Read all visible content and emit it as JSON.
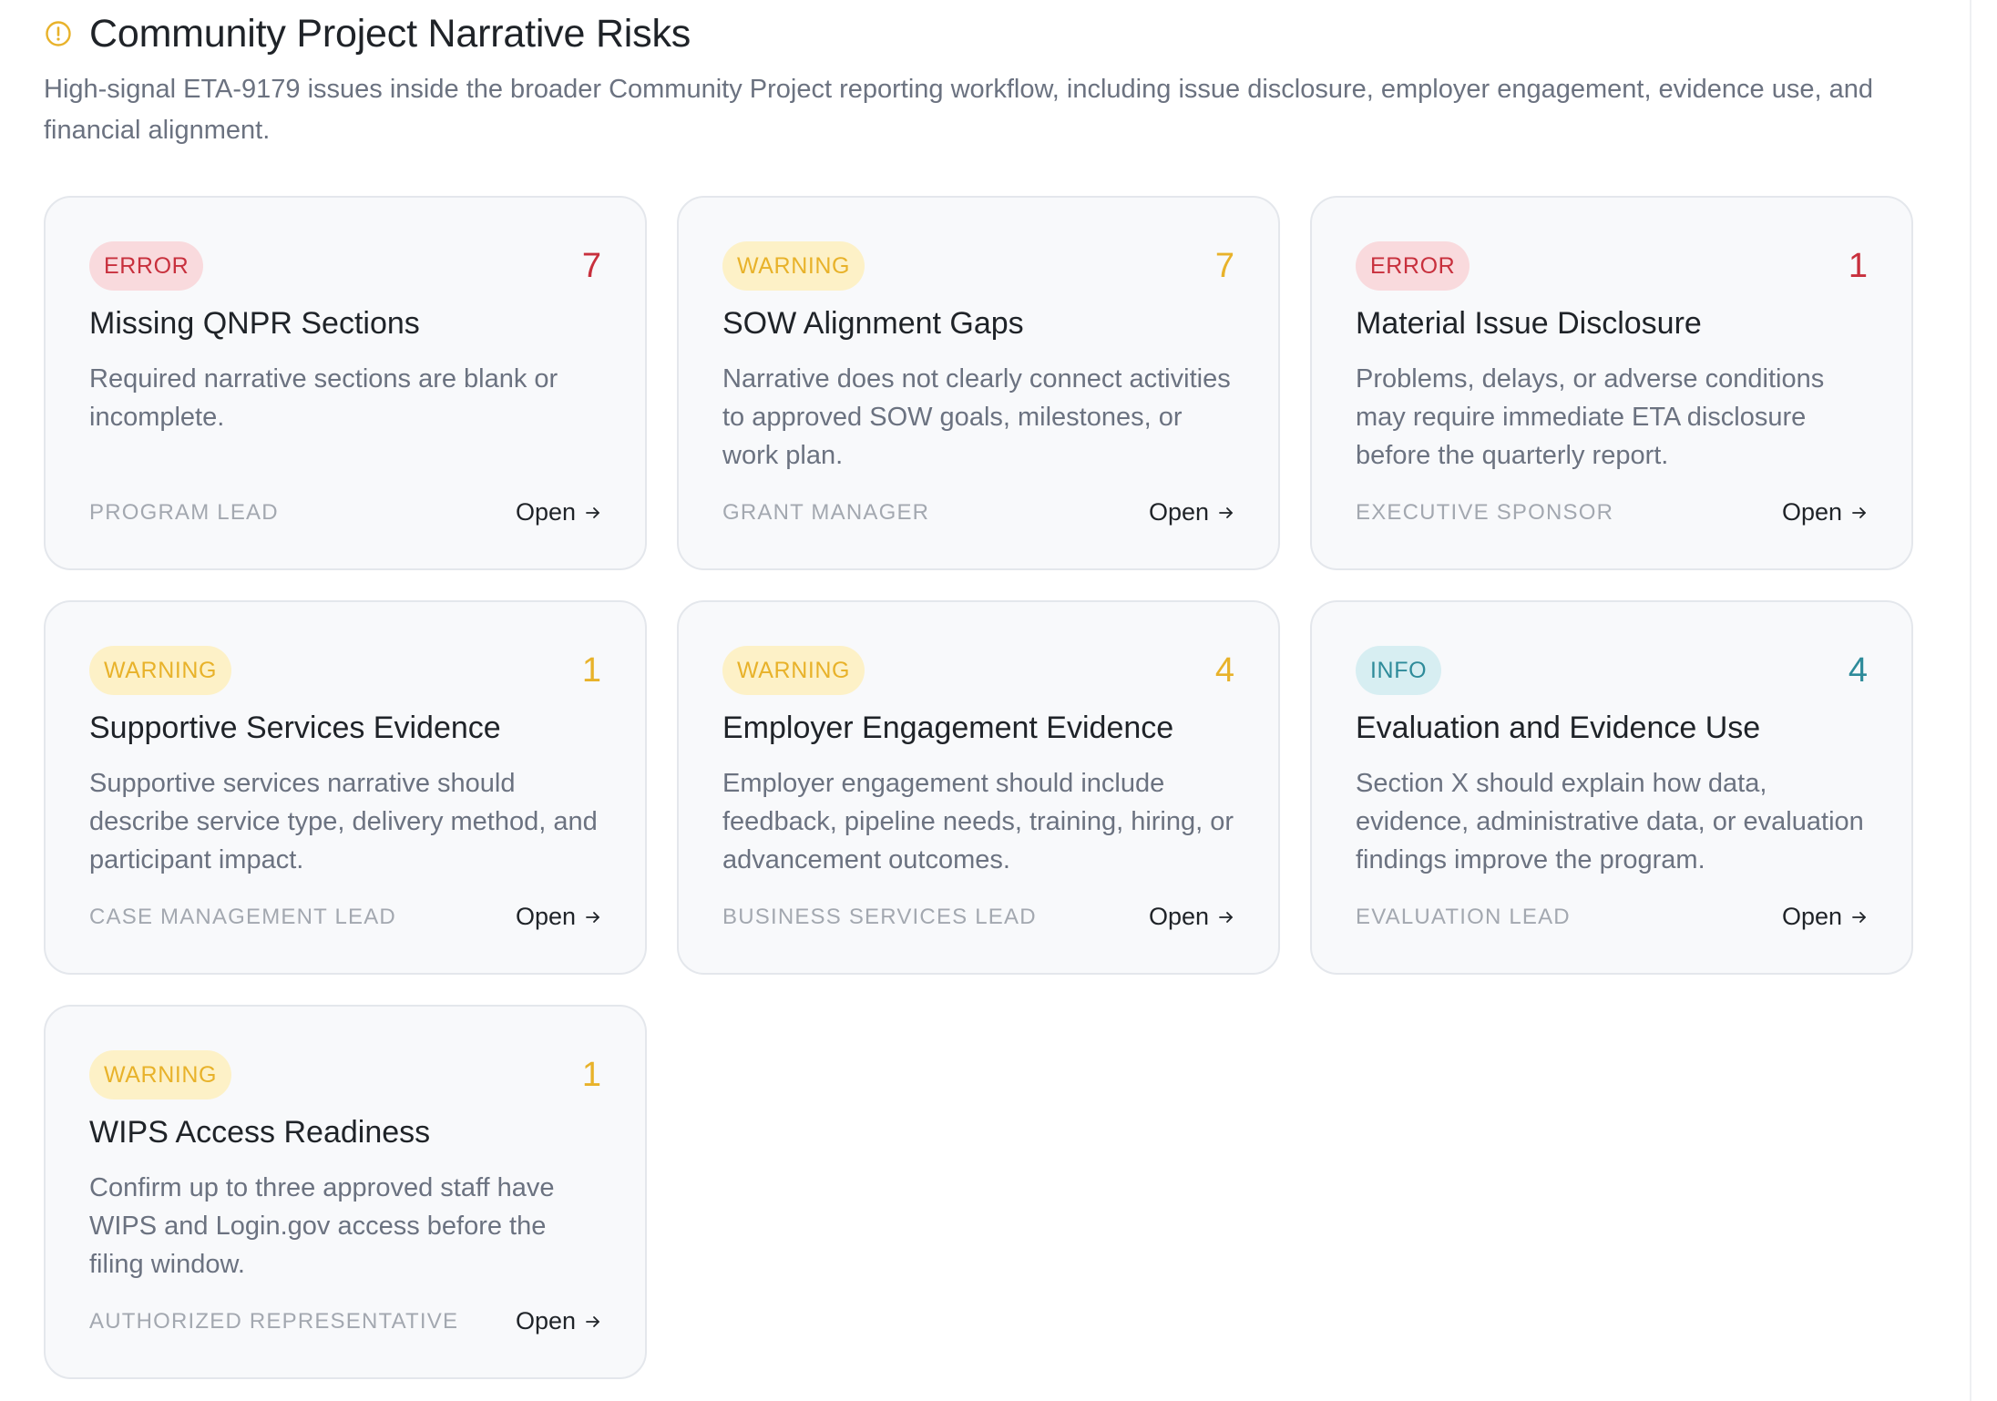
{
  "header": {
    "icon": "warning-circle-icon",
    "title": "Community Project Narrative Risks",
    "subtitle": "High-signal ETA-9179 issues inside the broader Community Project reporting workflow, including issue disclosure, employer engagement, evidence use, and financial alignment."
  },
  "colors": {
    "error": "#c8303d",
    "warning": "#e8b22a",
    "info": "#2e8b9a",
    "header_icon": "#e8b22a"
  },
  "cards": [
    {
      "severity": "error",
      "badge": "ERROR",
      "count": "7",
      "title": "Missing QNPR Sections",
      "description": "Required narrative sections are blank or incomplete.",
      "owner": "PROGRAM LEAD",
      "action": "Open"
    },
    {
      "severity": "warning",
      "badge": "WARNING",
      "count": "7",
      "title": "SOW Alignment Gaps",
      "description": "Narrative does not clearly connect activities to approved SOW goals, milestones, or work plan.",
      "owner": "GRANT MANAGER",
      "action": "Open"
    },
    {
      "severity": "error",
      "badge": "ERROR",
      "count": "1",
      "title": "Material Issue Disclosure",
      "description": "Problems, delays, or adverse conditions may require immediate ETA disclosure before the quarterly report.",
      "owner": "EXECUTIVE SPONSOR",
      "action": "Open"
    },
    {
      "severity": "warning",
      "badge": "WARNING",
      "count": "1",
      "title": "Supportive Services Evidence",
      "description": "Supportive services narrative should describe service type, delivery method, and participant impact.",
      "owner": "CASE MANAGEMENT LEAD",
      "action": "Open"
    },
    {
      "severity": "warning",
      "badge": "WARNING",
      "count": "4",
      "title": "Employer Engagement Evidence",
      "description": "Employer engagement should include feedback, pipeline needs, training, hiring, or advancement outcomes.",
      "owner": "BUSINESS SERVICES LEAD",
      "action": "Open"
    },
    {
      "severity": "info",
      "badge": "INFO",
      "count": "4",
      "title": "Evaluation and Evidence Use",
      "description": "Section X should explain how data, evidence, administrative data, or evaluation findings improve the program.",
      "owner": "EVALUATION LEAD",
      "action": "Open"
    },
    {
      "severity": "warning",
      "badge": "WARNING",
      "count": "1",
      "title": "WIPS Access Readiness",
      "description": "Confirm up to three approved staff have WIPS and Login.gov access before the filing window.",
      "owner": "AUTHORIZED REPRESENTATIVE",
      "action": "Open"
    }
  ]
}
